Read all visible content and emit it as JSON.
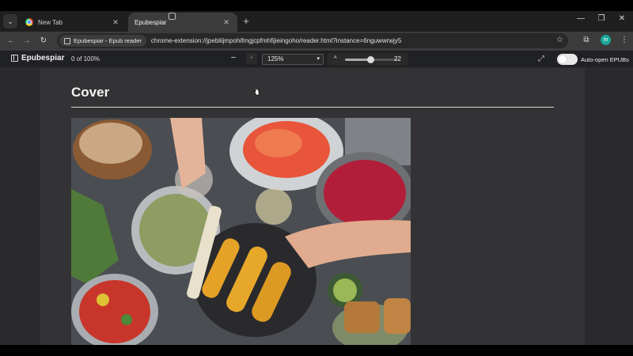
{
  "tabs": [
    {
      "title": "New Tab",
      "active": false
    },
    {
      "title": "Epubespiar",
      "active": true
    }
  ],
  "toolbar": {
    "site_chip": "Epubespiar - Epub reader",
    "url": "chrome-extension://jpebliijmpohifmgjcpfmhfijieingoho/reader.html?instance=6nguwwrwjy5",
    "profile_initial": "m"
  },
  "reader": {
    "brand": "Epubespiar",
    "progress": "0 of 100%",
    "zoom_value": "125%",
    "font_size_value": "22",
    "font_size_level": 0.55,
    "auto_open_label": "Auto-open EPUBs",
    "auto_open_enabled": true
  },
  "content": {
    "chapter_title": "Cover"
  },
  "colors": {
    "tabstrip": "#1f1f1f",
    "toolbar": "#3c3c3c",
    "reader_bar": "#202124",
    "page": "#333335",
    "profile": "#1aa79a"
  }
}
